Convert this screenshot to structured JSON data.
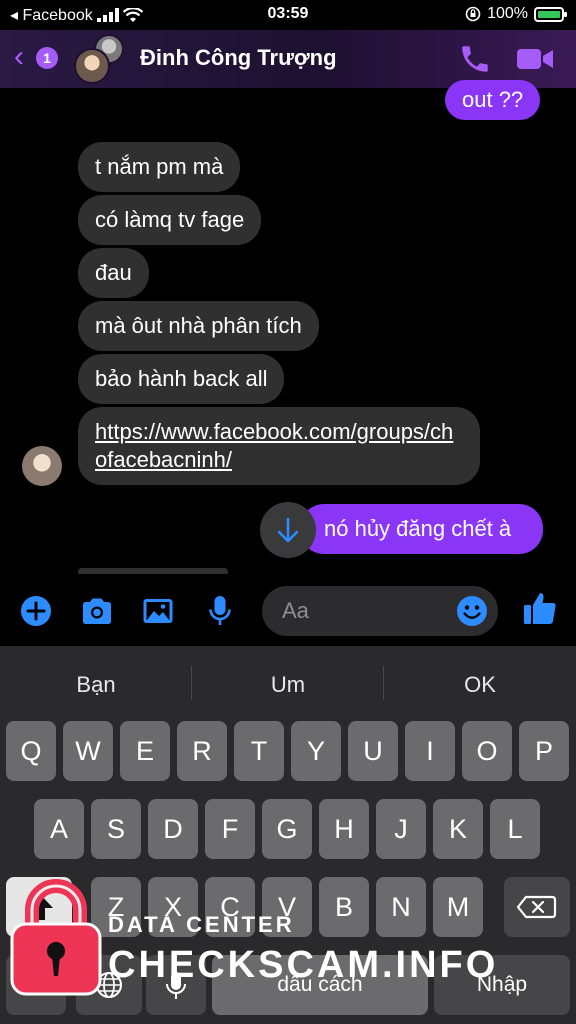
{
  "status_bar": {
    "back_app": "◂ Facebook",
    "time": "03:59",
    "battery": "100%"
  },
  "header": {
    "back_count": "1",
    "contact_name": "Đinh Công Trượng"
  },
  "messages": [
    {
      "dir": "out",
      "text": "out ??"
    },
    {
      "dir": "in",
      "text": "t nắm pm mà"
    },
    {
      "dir": "in",
      "text": "có làmq tv fage"
    },
    {
      "dir": "in",
      "text": "đau"
    },
    {
      "dir": "in",
      "text": "mà ôut nhà phân tích"
    },
    {
      "dir": "in",
      "text": "bảo hành back all"
    },
    {
      "dir": "in",
      "text": "https://www.facebook.com/groups/chofacebacninh/"
    },
    {
      "dir": "out",
      "text": "nó hủy đăng chết à"
    }
  ],
  "composer": {
    "placeholder": "Aa"
  },
  "keyboard": {
    "suggestions": [
      "Bạn",
      "Um",
      "OK"
    ],
    "row1": [
      "Q",
      "W",
      "E",
      "R",
      "T",
      "Y",
      "U",
      "I",
      "O",
      "P"
    ],
    "row2": [
      "A",
      "S",
      "D",
      "F",
      "G",
      "H",
      "J",
      "K",
      "L"
    ],
    "row3": [
      "Z",
      "X",
      "C",
      "V",
      "B",
      "N",
      "M"
    ],
    "space_label": "dấu cách",
    "return_label": "Nhập"
  },
  "watermark": {
    "line1": "DATA CENTER",
    "line2": "CHECKSCAM.INFO"
  },
  "colors": {
    "accent": "#a65cf7",
    "outgoing_bubble": "#8b36f7",
    "incoming_bubble": "#303030",
    "composer_icon": "#2d8cff",
    "watermark_lock": "#ee3556"
  }
}
